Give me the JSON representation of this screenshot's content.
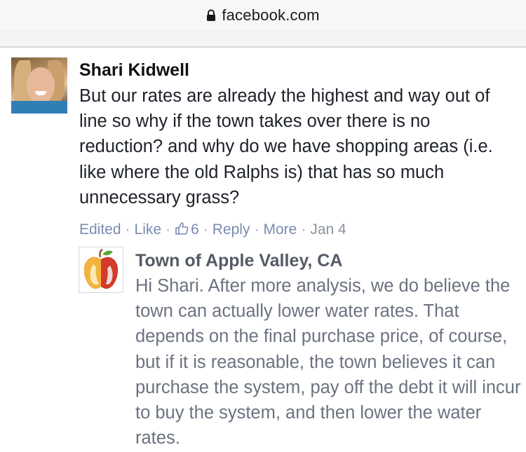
{
  "browser": {
    "domain": "facebook.com"
  },
  "comment": {
    "author": "Shari Kidwell",
    "text": "But our rates are already the highest and way out of line so why if the town takes over there is no reduction? and why do we have shopping areas (i.e. like where the old Ralphs is) that has so much unnecessary grass?",
    "actions": {
      "edited": "Edited",
      "like": "Like",
      "like_count": "6",
      "reply": "Reply",
      "more": "More",
      "date": "Jan 4"
    }
  },
  "reply": {
    "author": "Town of Apple Valley, CA",
    "text": "Hi Shari. After more analysis, we do believe the town can actually lower water rates. That depends on the final purchase price, of course, but if it is reasonable, the town believes it can purchase the system, pay off the debt it will incur to buy the system, and then lower the water rates."
  },
  "colors": {
    "link": "#7a8bb0",
    "meta": "#8d949e",
    "reply_text": "#6b7280"
  }
}
